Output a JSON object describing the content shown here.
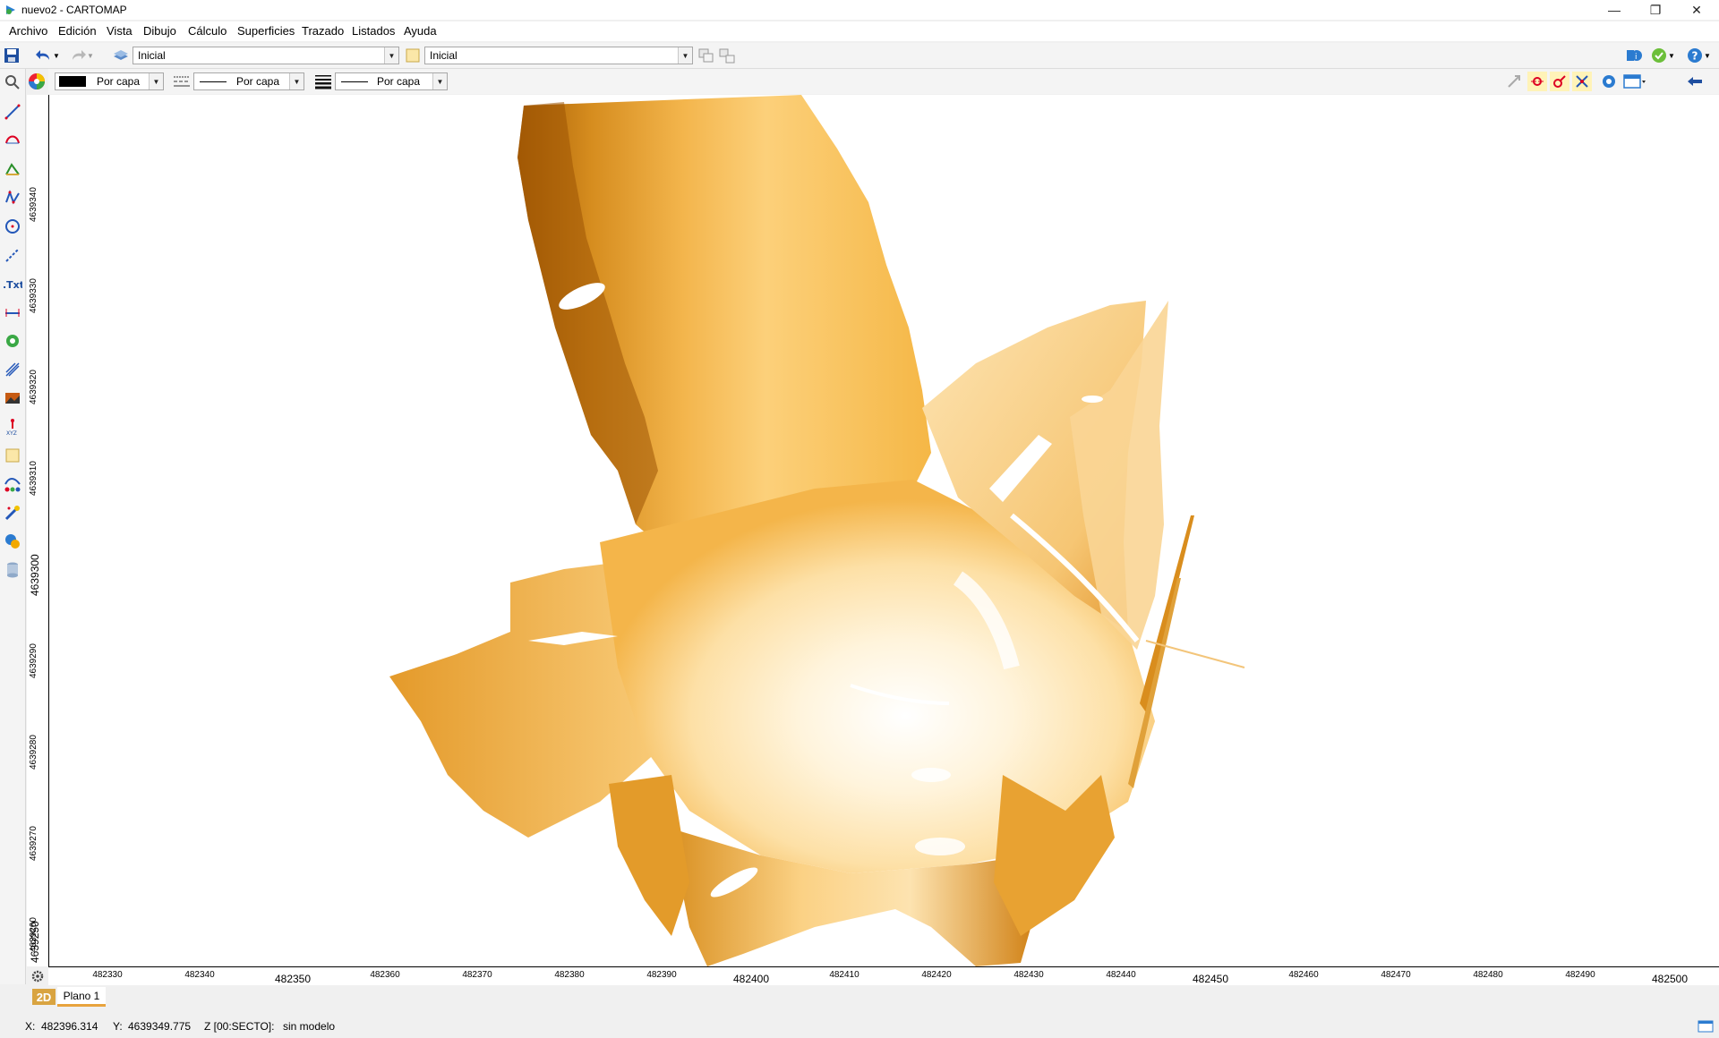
{
  "window": {
    "title": "nuevo2 - CARTOMAP",
    "minimize": "—",
    "restore": "❐",
    "close": "✕"
  },
  "menu": [
    "Archivo",
    "Edición",
    "Vista",
    "Dibujo",
    "Cálculo",
    "Superficies",
    "Trazado",
    "Listados",
    "Ayuda"
  ],
  "toolbar": {
    "layer_value": "Inicial",
    "style_value": "Inicial",
    "color_value": "Por capa",
    "linetype_value": "Por capa",
    "lineweight_value": "Por capa"
  },
  "rulers": {
    "y_ticks": [
      "4639340",
      "4639330",
      "4639320",
      "4639310",
      "4639300",
      "4639290",
      "4639280",
      "4639270",
      "4639260",
      "4639250"
    ],
    "x_ticks": [
      "482330",
      "482340",
      "482350",
      "482360",
      "482370",
      "482380",
      "482390",
      "482400",
      "482410",
      "482420",
      "482430",
      "482440",
      "482450",
      "482460",
      "482470",
      "482480",
      "482490",
      "482500"
    ]
  },
  "tabs": {
    "mode": "2D",
    "sheet": "Plano 1"
  },
  "status": {
    "x_label": "X:",
    "x_value": "482396.314",
    "y_label": "Y:",
    "y_value": "4639349.775",
    "z_label": "Z [00:SECTO]:",
    "z_value": "sin modelo"
  },
  "colors": {
    "accent": "#d9a441",
    "cloud_dark": "#b8690a",
    "cloud_light": "#fde3b0"
  },
  "icons": [
    "save-icon",
    "undo-icon",
    "redo-icon",
    "layer-icon",
    "style-icon",
    "zoom-icon",
    "color-wheel-icon",
    "line-icon",
    "arc-icon",
    "polyline-icon",
    "circle-icon",
    "text-icon",
    "settings-icon",
    "help-icon",
    "check-icon"
  ]
}
